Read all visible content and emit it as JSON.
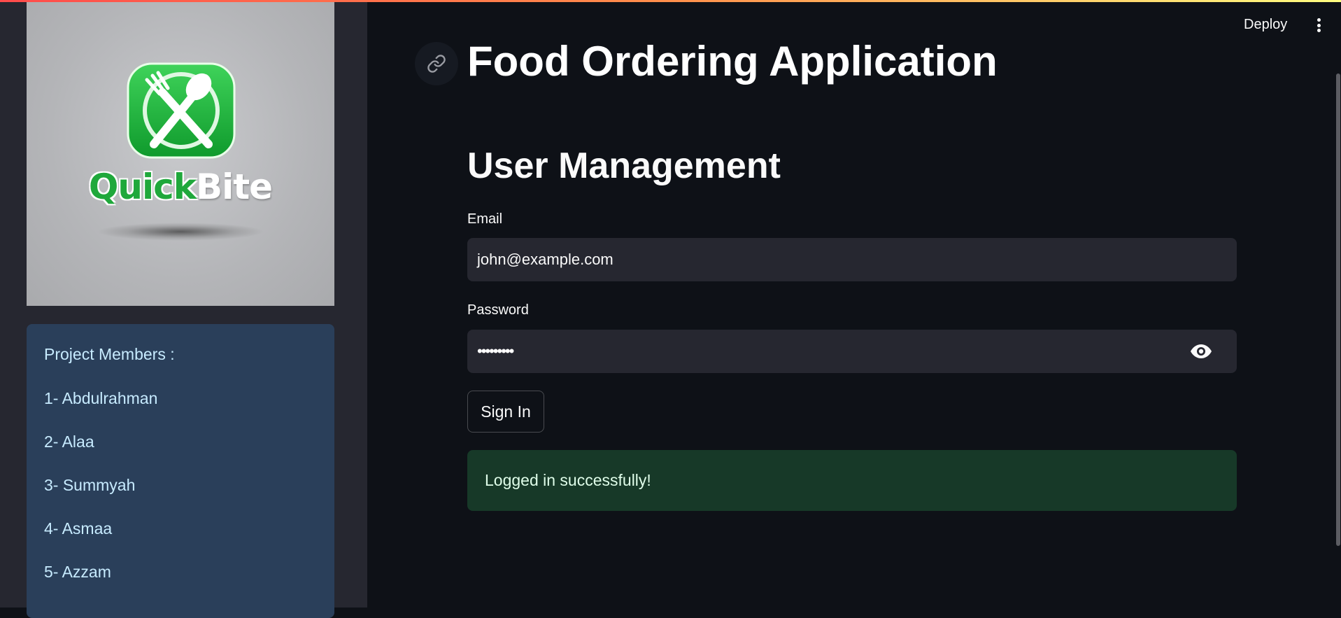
{
  "header": {
    "deploy_label": "Deploy",
    "menu_icon": "more-vertical-icon"
  },
  "sidebar": {
    "logo": {
      "text_part1": "Quick",
      "text_part2": "Bite",
      "icon": "fork-spoon-icon",
      "colors": {
        "green": "#1fa83b",
        "panel": "#b4b5b8"
      }
    },
    "members": {
      "heading": "Project Members :",
      "items": [
        "1- Abdulrahman",
        "2- Alaa",
        "3- Summyah",
        "4- Asmaa",
        "5- Azzam"
      ]
    }
  },
  "main": {
    "anchor_icon": "link-icon",
    "app_title": "Food Ordering Application",
    "section_title": "User Management",
    "email": {
      "label": "Email",
      "value": "john@example.com"
    },
    "password": {
      "label": "Password",
      "value": "•••••••••",
      "toggle_icon": "eye-icon"
    },
    "sign_in_label": "Sign In",
    "success_message": "Logged in successfully!"
  },
  "colors": {
    "background": "#0e1117",
    "sidebar": "#262730",
    "members_panel": "#2a3f5a",
    "success_bg": "#173928",
    "accent_gradient_start": "#ff4b4b"
  }
}
